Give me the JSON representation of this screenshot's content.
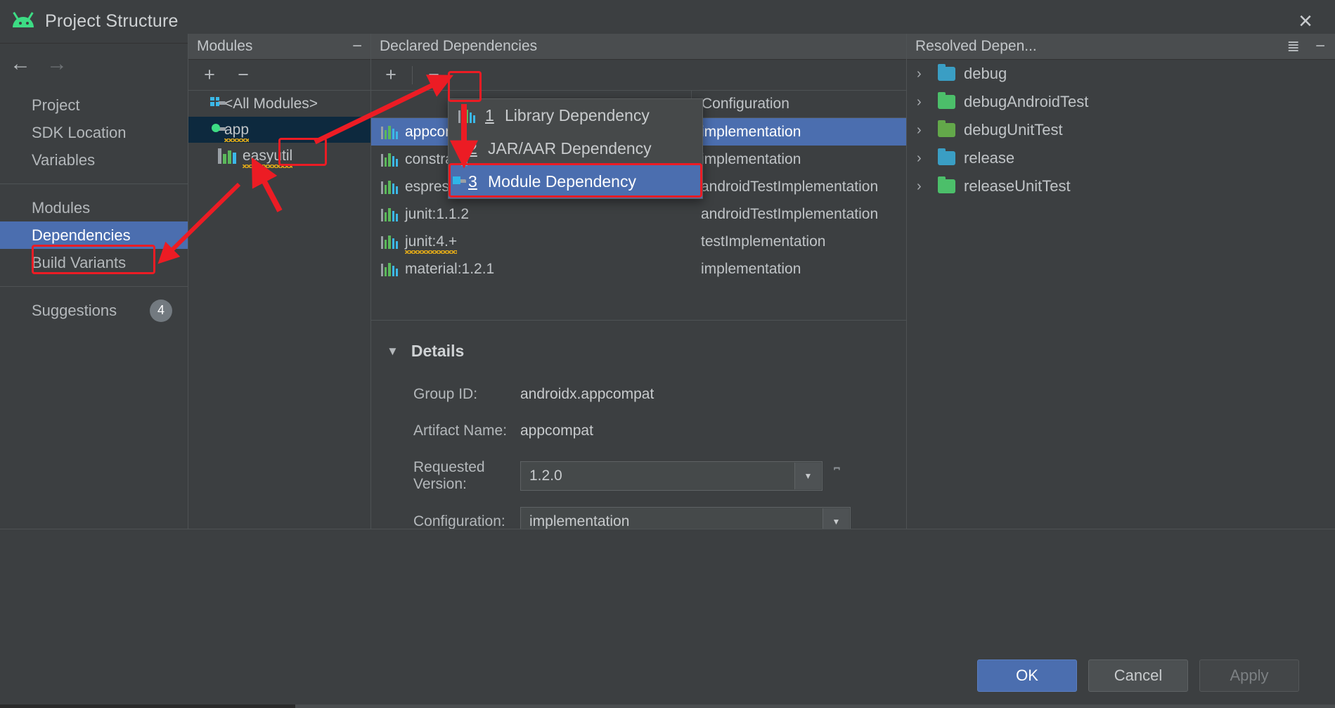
{
  "window": {
    "title": "Project Structure",
    "app_icon": "android-robot-icon",
    "close_label": "×"
  },
  "nav": {
    "back_icon": "←",
    "forward_icon": "→"
  },
  "sidebar": {
    "group1": [
      {
        "label": "Project",
        "selected": false
      },
      {
        "label": "SDK Location",
        "selected": false
      },
      {
        "label": "Variables",
        "selected": false
      }
    ],
    "group2": [
      {
        "label": "Modules",
        "selected": false
      },
      {
        "label": "Dependencies",
        "selected": true
      },
      {
        "label": "Build Variants",
        "selected": false
      }
    ],
    "group3": [
      {
        "label": "Suggestions",
        "badge": "4",
        "selected": false
      }
    ]
  },
  "modules_panel": {
    "title": "Modules",
    "collapse_icon": "−",
    "toolbar": {
      "add_label": "+",
      "remove_label": "−"
    },
    "items": [
      {
        "label": "<All Modules>",
        "icon": "folder-grid-icon",
        "selected": false,
        "squiggly": false
      },
      {
        "label": "app",
        "icon": "folder-green-dot-icon",
        "selected": true,
        "squiggly": true
      },
      {
        "label": "easyutil",
        "icon": "library-bars-icon",
        "selected": false,
        "squiggly": true
      }
    ]
  },
  "declared_panel": {
    "title": "Declared Dependencies",
    "toolbar": {
      "add_label": "+",
      "remove_label": "−"
    },
    "columns": {
      "name": "",
      "configuration": "Configuration"
    },
    "rows": [
      {
        "name": "appcompat:1.2.0",
        "configuration": "implementation",
        "selected": true,
        "icon": "library-bars-icon"
      },
      {
        "name": "constraintlayout:2.0.1",
        "configuration": "implementation",
        "selected": false,
        "icon": "library-bars-icon"
      },
      {
        "name": "espresso-core:3.3.0",
        "configuration": "androidTestImplementation",
        "selected": false,
        "icon": "library-bars-icon"
      },
      {
        "name": "junit:1.1.2",
        "configuration": "androidTestImplementation",
        "selected": false,
        "icon": "library-bars-icon"
      },
      {
        "name": "junit:4.+",
        "configuration": "testImplementation",
        "selected": false,
        "icon": "library-bars-icon",
        "squiggly": true
      },
      {
        "name": "material:1.2.1",
        "configuration": "implementation",
        "selected": false,
        "icon": "library-bars-icon"
      }
    ]
  },
  "details": {
    "title": "Details",
    "expand_icon": "▼",
    "group_id_label": "Group ID:",
    "group_id_value": "androidx.appcompat",
    "artifact_label": "Artifact Name:",
    "artifact_value": "appcompat",
    "version_label": "Requested Version:",
    "version_value": "1.2.0",
    "configuration_label": "Configuration:",
    "configuration_value": "implementation",
    "dropdown_icon": "▼",
    "version_extra_icon": "bracket-icon"
  },
  "resolved_panel": {
    "title": "Resolved Depen...",
    "expand_all_icon": "collapse-all-icon",
    "minimize_icon": "−",
    "items": [
      {
        "label": "debug",
        "chevron": "›",
        "color": "#3a9ec4"
      },
      {
        "label": "debugAndroidTest",
        "chevron": "›",
        "color": "#4cbf6a"
      },
      {
        "label": "debugUnitTest",
        "chevron": "›",
        "color": "#63a84a"
      },
      {
        "label": "release",
        "chevron": "›",
        "color": "#3a9ec4"
      },
      {
        "label": "releaseUnitTest",
        "chevron": "›",
        "color": "#4cbf6a"
      }
    ]
  },
  "popup_menu": {
    "items": [
      {
        "mnemonic": "1",
        "label": "Library Dependency",
        "icon": "library-bars-icon",
        "highlight": false
      },
      {
        "mnemonic": "2",
        "label": "JAR/AAR Dependency",
        "icon": "jar-icon",
        "highlight": false
      },
      {
        "mnemonic": "3",
        "label": "Module Dependency",
        "icon": "folder-module-icon",
        "highlight": true
      }
    ]
  },
  "footer": {
    "ok_label": "OK",
    "cancel_label": "Cancel",
    "apply_label": "Apply"
  },
  "annotations": {
    "accent_color": "#ec1c24",
    "boxes": [
      "dependencies-sidebar-item",
      "app-module-name",
      "declared-add-button",
      "module-dependency-menu-item"
    ],
    "arrows": [
      "arrow-to-dependencies",
      "arrow-to-app-module",
      "arrow-to-add-button",
      "arrow-to-module-dependency"
    ]
  }
}
